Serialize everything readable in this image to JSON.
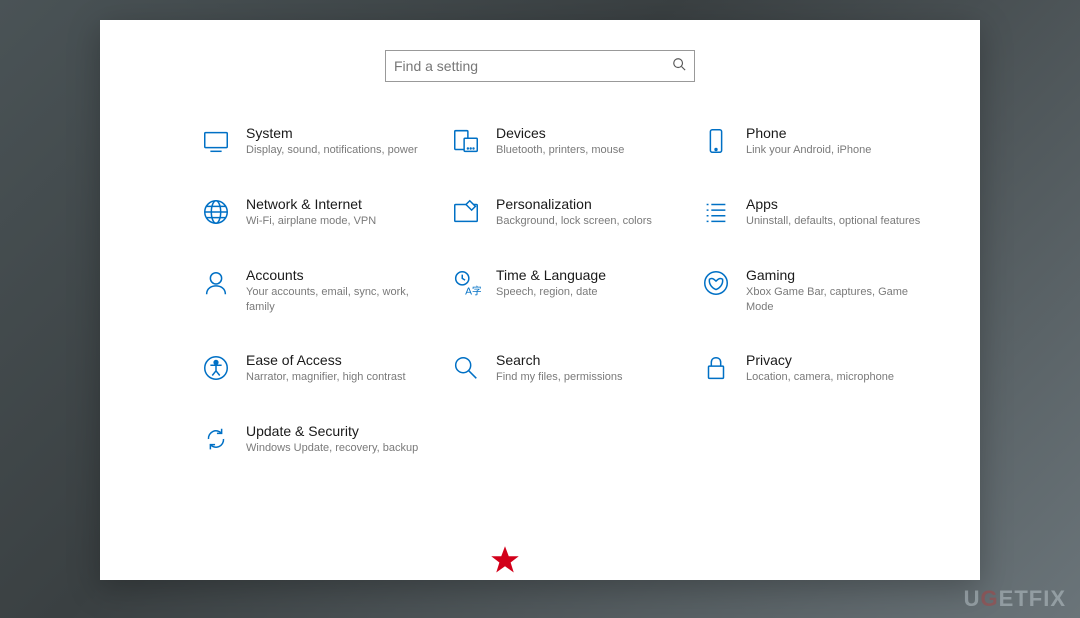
{
  "search": {
    "placeholder": "Find a setting"
  },
  "items": [
    {
      "title": "System",
      "desc": "Display, sound, notifications, power"
    },
    {
      "title": "Devices",
      "desc": "Bluetooth, printers, mouse"
    },
    {
      "title": "Phone",
      "desc": "Link your Android, iPhone"
    },
    {
      "title": "Network & Internet",
      "desc": "Wi-Fi, airplane mode, VPN"
    },
    {
      "title": "Personalization",
      "desc": "Background, lock screen, colors"
    },
    {
      "title": "Apps",
      "desc": "Uninstall, defaults, optional features"
    },
    {
      "title": "Accounts",
      "desc": "Your accounts, email, sync, work, family"
    },
    {
      "title": "Time & Language",
      "desc": "Speech, region, date"
    },
    {
      "title": "Gaming",
      "desc": "Xbox Game Bar, captures, Game Mode"
    },
    {
      "title": "Ease of Access",
      "desc": "Narrator, magnifier, high contrast"
    },
    {
      "title": "Search",
      "desc": "Find my files, permissions"
    },
    {
      "title": "Privacy",
      "desc": "Location, camera, microphone"
    },
    {
      "title": "Update & Security",
      "desc": "Windows Update, recovery, backup"
    }
  ],
  "watermark": {
    "part1": "U",
    "part2": "G",
    "part3": "ETFIX"
  }
}
